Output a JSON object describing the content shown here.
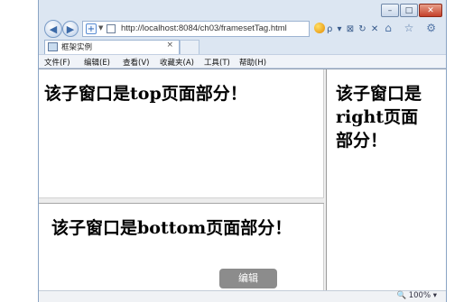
{
  "browser": {
    "url": "http://localhost:8084/ch03/framesetTag.html",
    "tab_title": "框架实例",
    "tab_close": "×",
    "nav_back_glyph": "◀",
    "nav_forward_glyph": "▶",
    "tools_glyphs": "ρ ▾ ⊠ ↻ ✕",
    "right_icons": "⌂ ☆ ⚙",
    "window_buttons": {
      "minimize": "–",
      "maximize": "□",
      "close": "✕"
    }
  },
  "menubar": {
    "items": [
      "文件(F)",
      "编辑(E)",
      "查看(V)",
      "收藏夹(A)",
      "工具(T)",
      "帮助(H)"
    ]
  },
  "frames": {
    "top": "该子窗口是top页面部分！",
    "bottom": "该子窗口是bottom页面部分！",
    "right": "该子窗口是right页面部分！"
  },
  "status": {
    "zoom": "🔍 100%  ▾"
  },
  "overlay": {
    "edit_label": "编辑"
  }
}
